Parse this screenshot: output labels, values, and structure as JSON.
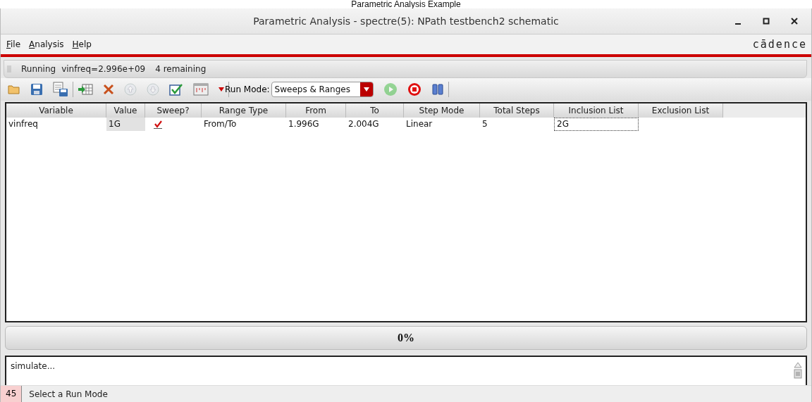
{
  "caption": "Parametric Analysis Example",
  "window": {
    "title": "Parametric Analysis - spectre(5): NPath testbench2 schematic"
  },
  "menu": [
    {
      "label": "File"
    },
    {
      "label": "Analysis"
    },
    {
      "label": "Help"
    }
  ],
  "brand": "cādence",
  "run_status": {
    "state": "Running",
    "point": "vinfreq=2.996e+09",
    "remaining": "4 remaining"
  },
  "toolbar": [
    {
      "kind": "open",
      "disabled": false
    },
    {
      "kind": "save",
      "disabled": false
    },
    {
      "kind": "save-as",
      "disabled": false
    },
    {
      "kind": "separator"
    },
    {
      "kind": "add-table",
      "disabled": false
    },
    {
      "kind": "delete",
      "disabled": false
    },
    {
      "kind": "up",
      "disabled": true
    },
    {
      "kind": "down",
      "disabled": true
    },
    {
      "kind": "check",
      "disabled": false
    },
    {
      "kind": "table-window",
      "disabled": false
    },
    {
      "kind": "dropdown",
      "disabled": false
    },
    {
      "kind": "separator"
    }
  ],
  "run_mode": {
    "label": "Run Mode:",
    "value": "Sweeps & Ranges"
  },
  "run_controls": [
    {
      "kind": "play",
      "disabled": true
    },
    {
      "kind": "stop",
      "disabled": false
    },
    {
      "kind": "pause",
      "disabled": false
    }
  ],
  "table": {
    "columns": [
      "Variable",
      "Value",
      "Sweep?",
      "Range Type",
      "From",
      "To",
      "Step Mode",
      "Total Steps",
      "Inclusion List",
      "Exclusion List"
    ],
    "rows": [
      {
        "cells": [
          {
            "kind": "text",
            "text": "vinfreq",
            "editable": true,
            "focused": false
          },
          {
            "kind": "text",
            "text": "1G",
            "editable": false,
            "focused": false
          },
          {
            "kind": "checkbox",
            "checked": true,
            "editable": true,
            "focused": false
          },
          {
            "kind": "text",
            "text": "From/To",
            "editable": true,
            "focused": false
          },
          {
            "kind": "text",
            "text": "1.996G",
            "editable": true,
            "focused": false
          },
          {
            "kind": "text",
            "text": "2.004G",
            "editable": true,
            "focused": false
          },
          {
            "kind": "text",
            "text": "Linear",
            "editable": true,
            "focused": false
          },
          {
            "kind": "text",
            "text": "5",
            "editable": true,
            "focused": false
          },
          {
            "kind": "text",
            "text": "2G",
            "editable": true,
            "focused": true
          }
        ]
      }
    ]
  },
  "progress": {
    "level": 0,
    "text": "0%"
  },
  "log": {
    "text": "simulate..."
  },
  "status_bar": {
    "line": "45",
    "message": "Select a Run Mode"
  }
}
